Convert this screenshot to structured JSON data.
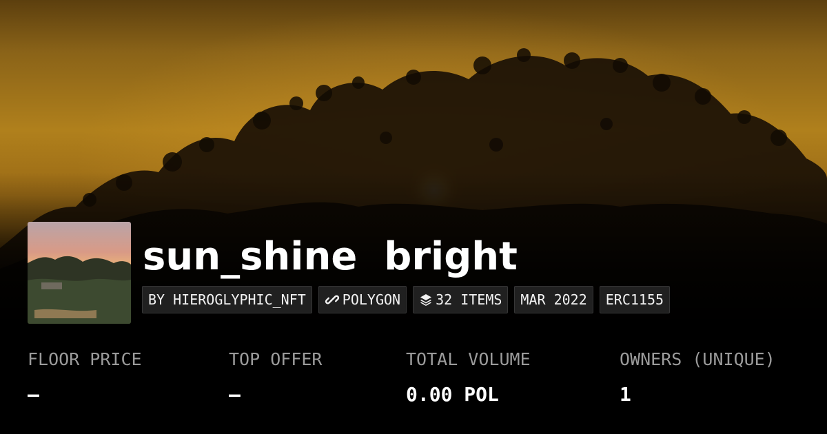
{
  "collection": {
    "title": "sun_shine  bright",
    "creator": "BY HIEROGLYPHIC_NFT",
    "chain": "POLYGON",
    "items": "32 ITEMS",
    "created": "MAR 2022",
    "standard": "ERC1155"
  },
  "stats": [
    {
      "label": "FLOOR PRICE",
      "value": "–"
    },
    {
      "label": "TOP OFFER",
      "value": "–"
    },
    {
      "label": "TOTAL VOLUME",
      "value": "0.00 POL"
    },
    {
      "label": "OWNERS (UNIQUE)",
      "value": "1"
    }
  ],
  "icons": {
    "chain": "link-icon",
    "items": "layers-icon"
  },
  "colors": {
    "background": "#000000",
    "sky_amber": "#b0801c",
    "pill_background": "#262626",
    "label_gray": "#9b9b9b",
    "text_white": "#ffffff"
  }
}
